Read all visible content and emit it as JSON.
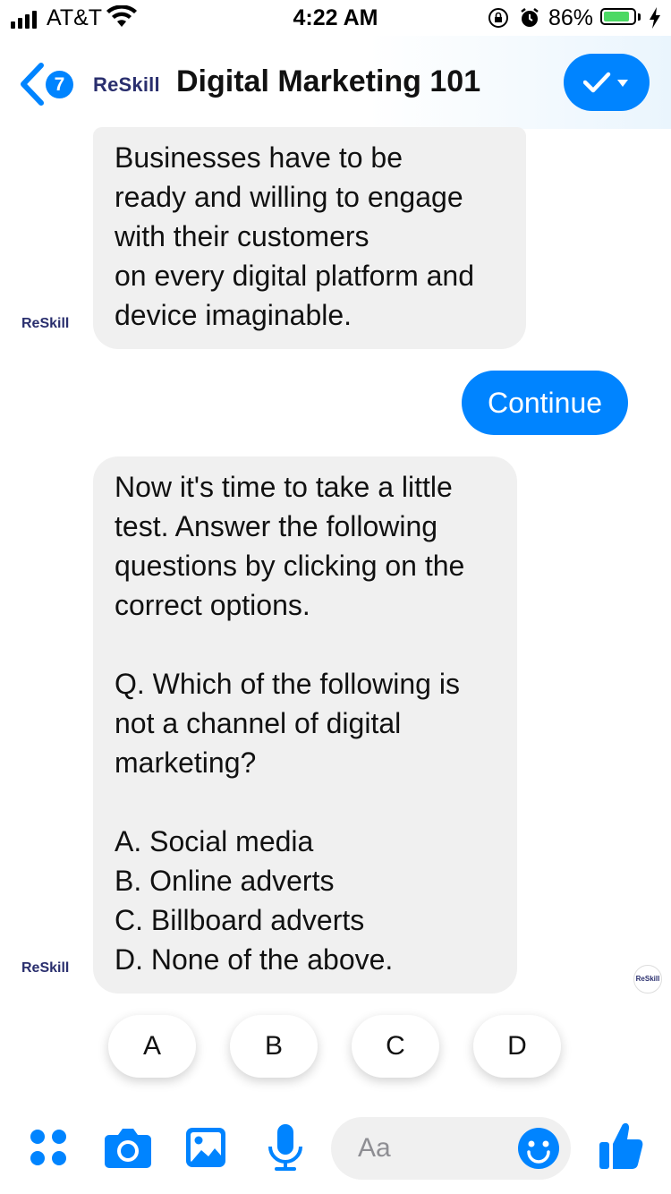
{
  "status_bar": {
    "carrier": "AT&T",
    "time": "4:22 AM",
    "battery_percent": "86%",
    "battery_level": 0.86
  },
  "header": {
    "unread_count": "7",
    "brand": "ReSkill",
    "title": "Digital Marketing 101"
  },
  "messages": [
    {
      "sender": "ReSkill",
      "text": "Businesses have to be\nready and willing to engage\nwith their customers\non every digital platform and\ndevice imaginable."
    },
    {
      "sender": "user",
      "text": "Continue"
    },
    {
      "sender": "ReSkill",
      "text": "Now it's time to take a little\ntest. Answer the following\nquestions by clicking on the\ncorrect options.\n\nQ. Which of the following is\nnot a channel of digital\nmarketing?\n\nA. Social media\nB. Online adverts\nC. Billboard adverts\nD. None of the above."
    }
  ],
  "read_receipt": "ReSkill",
  "quick_replies": [
    "A",
    "B",
    "C",
    "D"
  ],
  "composer": {
    "placeholder": "Aa"
  },
  "colors": {
    "accent": "#0084ff",
    "bubble_incoming": "#f0f0f0",
    "brand_text": "#2a2f6e"
  },
  "icons": [
    "menu-dots-icon",
    "camera-icon",
    "image-icon",
    "microphone-icon",
    "emoji-icon",
    "thumbs-up-icon"
  ]
}
